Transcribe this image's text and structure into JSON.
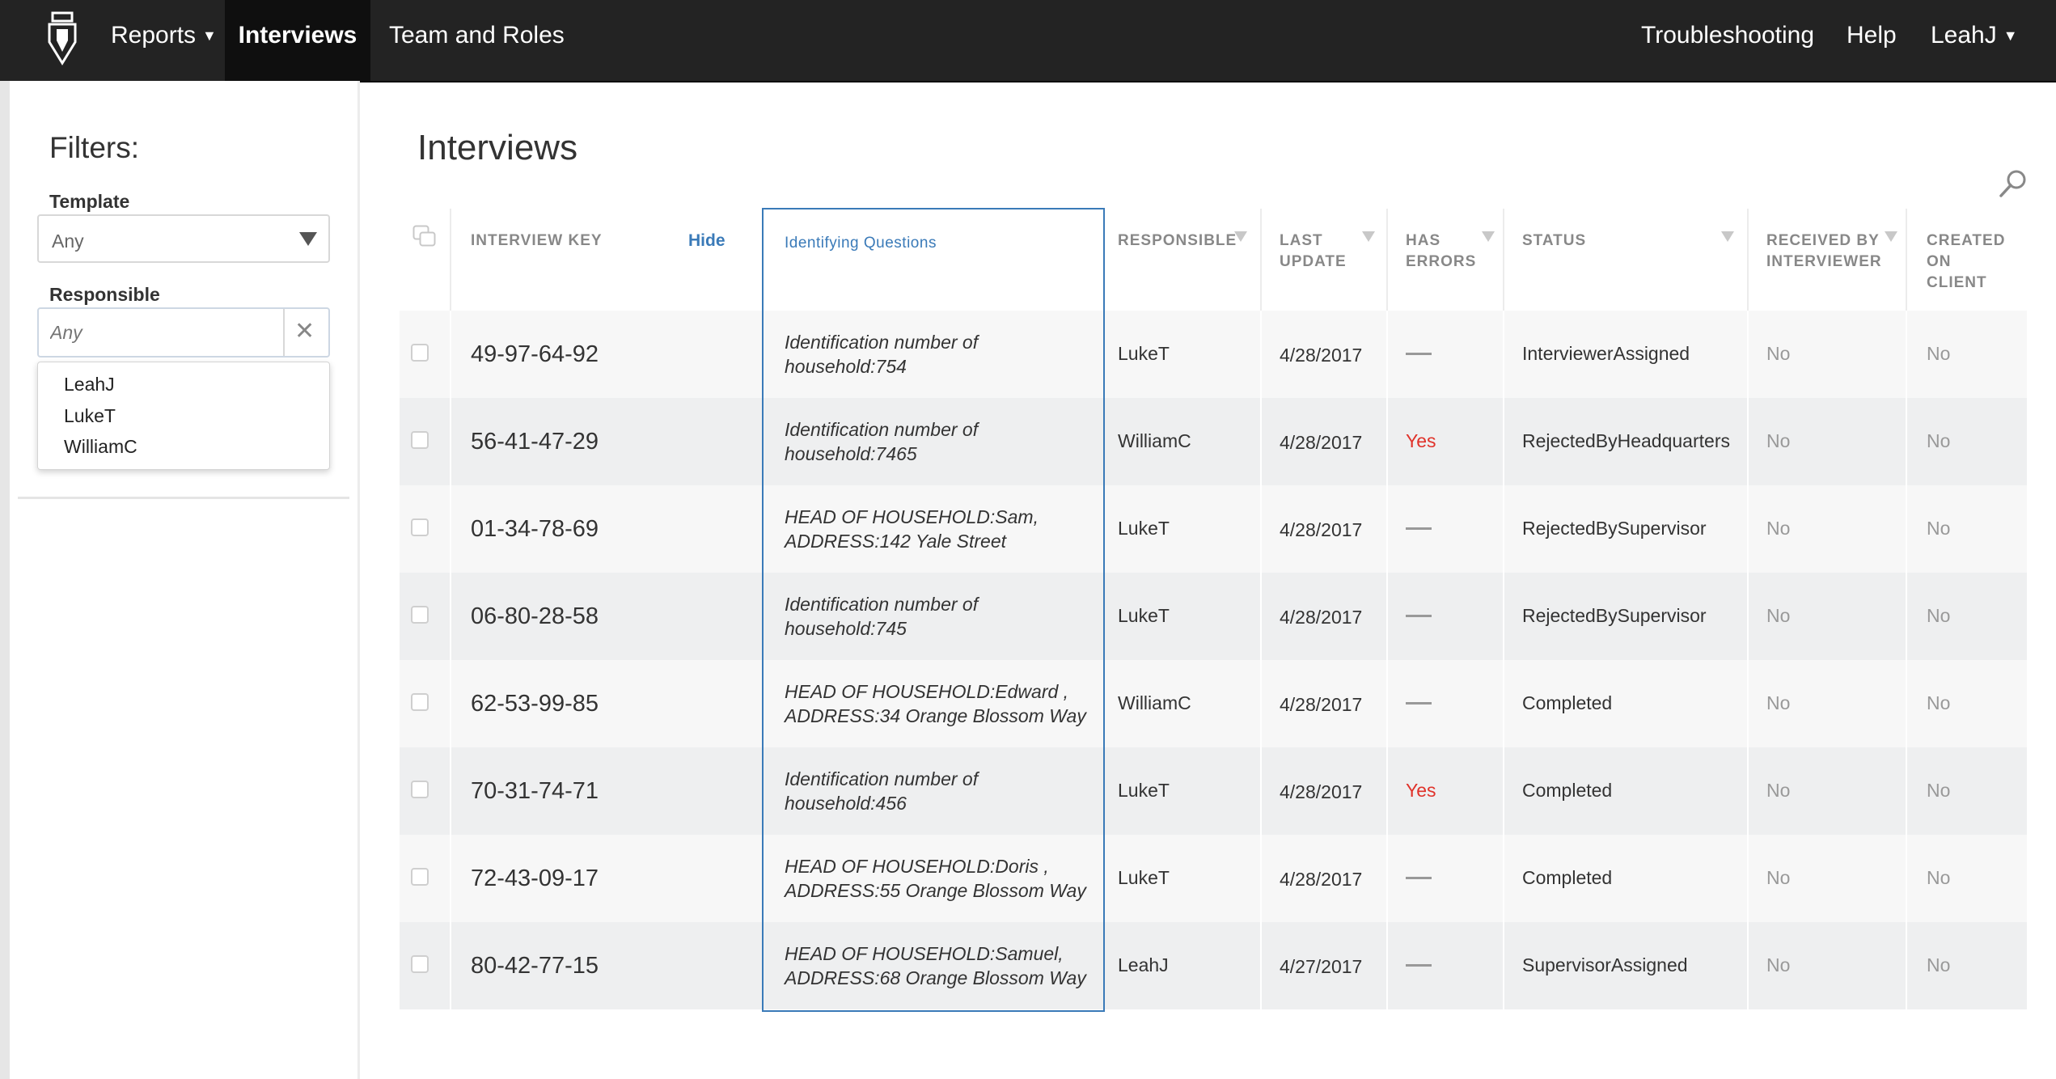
{
  "nav": {
    "items": [
      {
        "label": "Reports",
        "has_caret": true
      },
      {
        "label": "Interviews",
        "active": true
      },
      {
        "label": "Team and Roles"
      }
    ],
    "right": [
      {
        "label": "Troubleshooting"
      },
      {
        "label": "Help"
      },
      {
        "label": "LeahJ",
        "has_caret": true
      }
    ],
    "caret": "▼"
  },
  "filters": {
    "title": "Filters:",
    "template": {
      "label": "Template",
      "value": "Any"
    },
    "responsible": {
      "label": "Responsible",
      "placeholder": "Any",
      "clear": "✕",
      "options": [
        "LeahJ",
        "LukeT",
        "WilliamC"
      ]
    }
  },
  "main": {
    "title": "Interviews",
    "columns": {
      "interview_key": "INTERVIEW KEY",
      "hide": "Hide",
      "identifying_questions": "Identifying Questions",
      "responsible": "RESPONSIBLE",
      "last_update": [
        "LAST",
        "UPDATE"
      ],
      "has_errors": [
        "HAS",
        "ERRORS"
      ],
      "status": "STATUS",
      "received": [
        "RECEIVED BY",
        "INTERVIEWER"
      ],
      "created": [
        "CREATED",
        "ON",
        "CLIENT"
      ]
    },
    "rows": [
      {
        "key": "49-97-64-92",
        "idq": [
          "Identification number of",
          "household:754"
        ],
        "responsible": "LukeT",
        "last_update": "4/28/2017",
        "has_errors": "",
        "status": "InterviewerAssigned",
        "received": "No",
        "created": "No"
      },
      {
        "key": "56-41-47-29",
        "idq": [
          "Identification number of",
          "household:7465"
        ],
        "responsible": "WilliamC",
        "last_update": "4/28/2017",
        "has_errors": "Yes",
        "status": "RejectedByHeadquarters",
        "received": "No",
        "created": "No"
      },
      {
        "key": "01-34-78-69",
        "idq": [
          "HEAD OF HOUSEHOLD:Sam,",
          "ADDRESS:142 Yale Street"
        ],
        "responsible": "LukeT",
        "last_update": "4/28/2017",
        "has_errors": "",
        "status": "RejectedBySupervisor",
        "received": "No",
        "created": "No"
      },
      {
        "key": "06-80-28-58",
        "idq": [
          "Identification number of",
          "household:745"
        ],
        "responsible": "LukeT",
        "last_update": "4/28/2017",
        "has_errors": "",
        "status": "RejectedBySupervisor",
        "received": "No",
        "created": "No"
      },
      {
        "key": "62-53-99-85",
        "idq": [
          "HEAD OF HOUSEHOLD:Edward ,",
          "ADDRESS:34 Orange Blossom Way"
        ],
        "responsible": "WilliamC",
        "last_update": "4/28/2017",
        "has_errors": "",
        "status": "Completed",
        "received": "No",
        "created": "No"
      },
      {
        "key": "70-31-74-71",
        "idq": [
          "Identification number of",
          "household:456"
        ],
        "responsible": "LukeT",
        "last_update": "4/28/2017",
        "has_errors": "Yes",
        "status": "Completed",
        "received": "No",
        "created": "No"
      },
      {
        "key": "72-43-09-17",
        "idq": [
          "HEAD OF HOUSEHOLD:Doris ,",
          "ADDRESS:55 Orange Blossom Way"
        ],
        "responsible": "LukeT",
        "last_update": "4/28/2017",
        "has_errors": "",
        "status": "Completed",
        "received": "No",
        "created": "No"
      },
      {
        "key": "80-42-77-15",
        "idq": [
          "HEAD OF HOUSEHOLD:Samuel,",
          "ADDRESS:68 Orange Blossom Way"
        ],
        "responsible": "LeahJ",
        "last_update": "4/27/2017",
        "has_errors": "",
        "status": "SupervisorAssigned",
        "received": "No",
        "created": "No"
      }
    ]
  },
  "colors": {
    "accent": "#3a7ab8",
    "error": "#e0322a",
    "nav_bg": "#232323"
  }
}
